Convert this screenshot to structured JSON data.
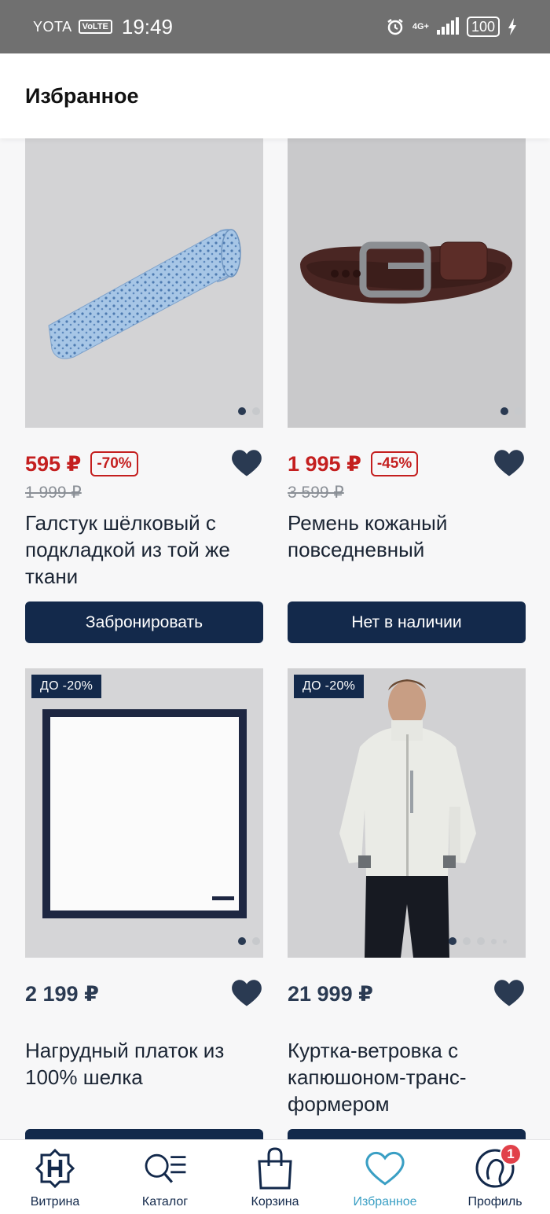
{
  "status_bar": {
    "carrier": "YOTA",
    "volte": "VoLTE",
    "time": "19:49",
    "network": "4G+",
    "battery": "100"
  },
  "header": {
    "title": "Избранное"
  },
  "products": [
    {
      "price": "595 ₽",
      "discount": "-70%",
      "old_price": "1 999 ₽",
      "title": "Галстук шёлковый с подкладкой из той же ткани",
      "button": "Забронировать",
      "image": "tie-icon",
      "gallery_dots": 2,
      "gallery_active": 1
    },
    {
      "price": "1 995 ₽",
      "discount": "-45%",
      "old_price": "3 599 ₽",
      "title": "Ремень кожаный повседневный",
      "button": "Нет в наличии",
      "image": "belt-icon",
      "gallery_dots": 2,
      "gallery_active": 1
    },
    {
      "promo": "ДО -20%",
      "price": "2 199 ₽",
      "title": "Нагрудный платок из 100% шелка",
      "image": "pocket-square-icon",
      "gallery_dots": 2,
      "gallery_active": 1
    },
    {
      "promo": "ДО -20%",
      "price": "21 999 ₽",
      "title": "Куртка-ветровка с капюшоном-транс-формером",
      "image": "jacket-icon",
      "gallery_dots": 5,
      "gallery_active": 1
    }
  ],
  "bottom_nav": [
    {
      "label": "Витрина",
      "icon": "home-logo-icon"
    },
    {
      "label": "Каталог",
      "icon": "catalog-search-icon"
    },
    {
      "label": "Корзина",
      "icon": "cart-bag-icon"
    },
    {
      "label": "Избранное",
      "icon": "heart-icon",
      "active": true
    },
    {
      "label": "Профиль",
      "icon": "profile-icon",
      "badge": "1"
    }
  ],
  "colors": {
    "primary": "#13294b",
    "sale": "#c41f1f",
    "active_tab": "#3a9fc4",
    "badge": "#e1414a"
  }
}
